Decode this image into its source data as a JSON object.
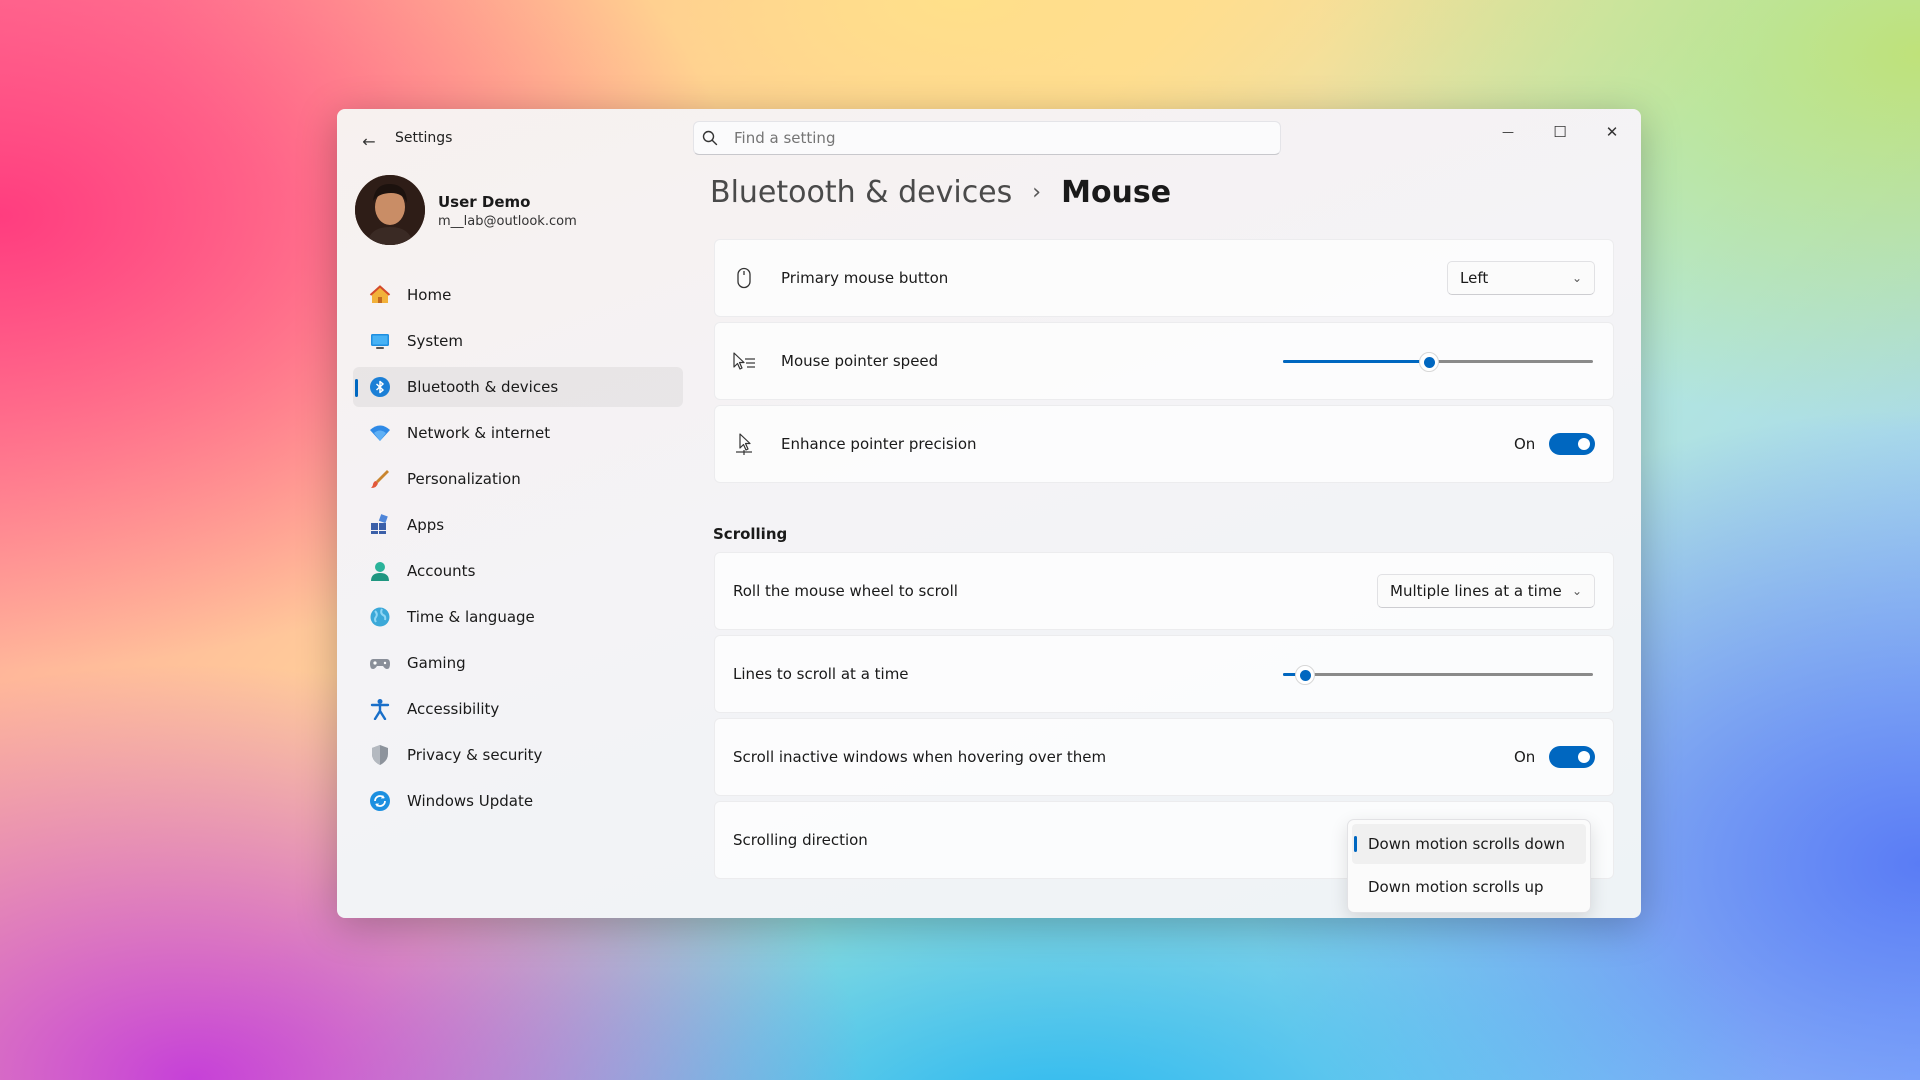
{
  "window": {
    "back_glyph": "←",
    "title": "Settings",
    "controls": {
      "minimize": "—",
      "maximize": "☐",
      "close": "✕"
    }
  },
  "search": {
    "placeholder": "Find a setting"
  },
  "user": {
    "name": "User Demo",
    "email": "m__lab@outlook.com"
  },
  "sidebar": {
    "items": [
      {
        "label": "Home",
        "icon": "home-icon",
        "active": false
      },
      {
        "label": "System",
        "icon": "system-icon",
        "active": false
      },
      {
        "label": "Bluetooth & devices",
        "icon": "bluetooth-icon",
        "active": true
      },
      {
        "label": "Network & internet",
        "icon": "wifi-icon",
        "active": false
      },
      {
        "label": "Personalization",
        "icon": "brush-icon",
        "active": false
      },
      {
        "label": "Apps",
        "icon": "apps-icon",
        "active": false
      },
      {
        "label": "Accounts",
        "icon": "accounts-icon",
        "active": false
      },
      {
        "label": "Time & language",
        "icon": "globe-icon",
        "active": false
      },
      {
        "label": "Gaming",
        "icon": "gamepad-icon",
        "active": false
      },
      {
        "label": "Accessibility",
        "icon": "accessibility-icon",
        "active": false
      },
      {
        "label": "Privacy & security",
        "icon": "shield-icon",
        "active": false
      },
      {
        "label": "Windows Update",
        "icon": "update-icon",
        "active": false
      }
    ]
  },
  "breadcrumb": {
    "parent": "Bluetooth & devices",
    "separator": "›",
    "current": "Mouse"
  },
  "settings": {
    "primary_button": {
      "label": "Primary mouse button",
      "value": "Left",
      "icon": "mouse-icon"
    },
    "pointer_speed": {
      "label": "Mouse pointer speed",
      "icon": "pointer-speed-icon",
      "level": 0.47
    },
    "pointer_precision": {
      "label": "Enhance pointer precision",
      "state": "On",
      "icon": "pointer-precision-icon",
      "on": true
    },
    "scrolling_heading": "Scrolling",
    "wheel_scroll": {
      "label": "Roll the mouse wheel to scroll",
      "value": "Multiple lines at a time"
    },
    "lines_to_scroll": {
      "label": "Lines to scroll at a time",
      "level": 0.04
    },
    "inactive_scroll": {
      "label": "Scroll inactive windows when hovering over them",
      "state": "On",
      "on": true
    },
    "scroll_direction": {
      "label": "Scrolling direction",
      "options": [
        "Down motion scrolls down",
        "Down motion scrolls up"
      ],
      "selected_index": 0
    }
  },
  "colors": {
    "accent": "#0067c0"
  }
}
